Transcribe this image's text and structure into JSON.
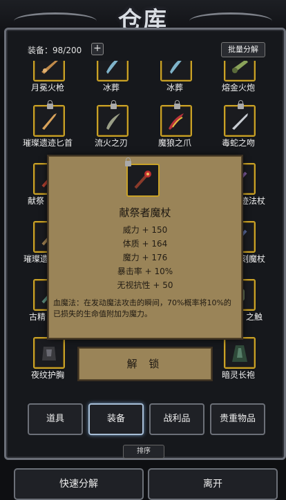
{
  "header": {
    "title": "仓库"
  },
  "toolbar": {
    "equip_label": "装备：98/200",
    "plus_label": "+",
    "batch_label": "批量分解"
  },
  "items": [
    {
      "name": "月冕火枪",
      "icon": "rifle-icon"
    },
    {
      "name": "冰葬",
      "icon": "ice-blade-icon"
    },
    {
      "name": "冰葬",
      "icon": "ice-blade-icon"
    },
    {
      "name": "熔金火炮",
      "icon": "cannon-icon"
    },
    {
      "name": "璀璨遗迹匕首",
      "icon": "dagger-icon"
    },
    {
      "name": "流火之刃",
      "icon": "blade-icon"
    },
    {
      "name": "魔狼之爪",
      "icon": "claw-icon"
    },
    {
      "name": "毒蛇之吻",
      "icon": "dagger-icon"
    },
    {
      "name": "献祭",
      "icon": "staff-icon"
    },
    {
      "name": "迹法杖",
      "icon": "staff-icon"
    },
    {
      "name": "璀璨遗",
      "icon": "staff-icon"
    },
    {
      "name": "刻魔杖",
      "icon": "staff-icon"
    },
    {
      "name": "古精",
      "icon": "staff-icon"
    },
    {
      "name": "之触",
      "icon": "glove-icon"
    },
    {
      "name": "夜纹护胸",
      "icon": "armor-icon"
    },
    {
      "name": "暗灵长袍",
      "icon": "robe-icon"
    }
  ],
  "popup": {
    "name": "献祭者魔杖",
    "stats": [
      "威力 + 150",
      "体质 + 164",
      "魔力 + 176",
      "暴击率 + 10%",
      "无视抗性 + 50"
    ],
    "description": "血魔法：在发动魔法攻击的瞬间，70%概率将10%的已损失的生命值附加为魔力。",
    "unlock_label": "解 锁"
  },
  "tabs": [
    {
      "label": "道具"
    },
    {
      "label": "装备"
    },
    {
      "label": "战利品"
    },
    {
      "label": "贵重物品"
    }
  ],
  "sort_label": "排序",
  "bottom": {
    "decompose_label": "快速分解",
    "leave_label": "离开"
  },
  "colors": {
    "gold_border": "#c9a227",
    "parchment": "#9a8458",
    "active_tab_glow": "#a9c0d8"
  }
}
